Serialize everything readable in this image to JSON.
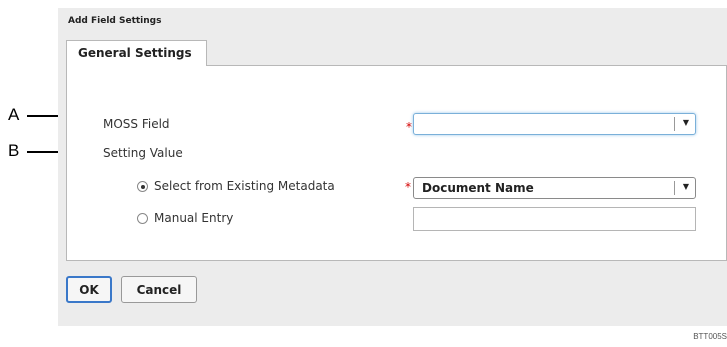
{
  "dialog": {
    "title": "Add Field Settings",
    "tab_label": "General Settings"
  },
  "form": {
    "moss_field_label": "MOSS Field",
    "moss_field_value": "",
    "setting_value_label": "Setting Value",
    "required_marker": "*",
    "option_existing_label": "Select from Existing Metadata",
    "option_existing_selected": true,
    "existing_metadata_value": "Document Name",
    "option_manual_label": "Manual Entry",
    "option_manual_selected": false,
    "manual_entry_value": ""
  },
  "buttons": {
    "ok": "OK",
    "cancel": "Cancel"
  },
  "callouts": {
    "a": "A",
    "b": "B"
  },
  "figure_ref": "BTT005S",
  "icons": {
    "dropdown": "chevron-down-icon"
  },
  "colors": {
    "required": "#d40000",
    "focus": "#7ab0d9",
    "primary_button_border": "#3a78c9"
  }
}
